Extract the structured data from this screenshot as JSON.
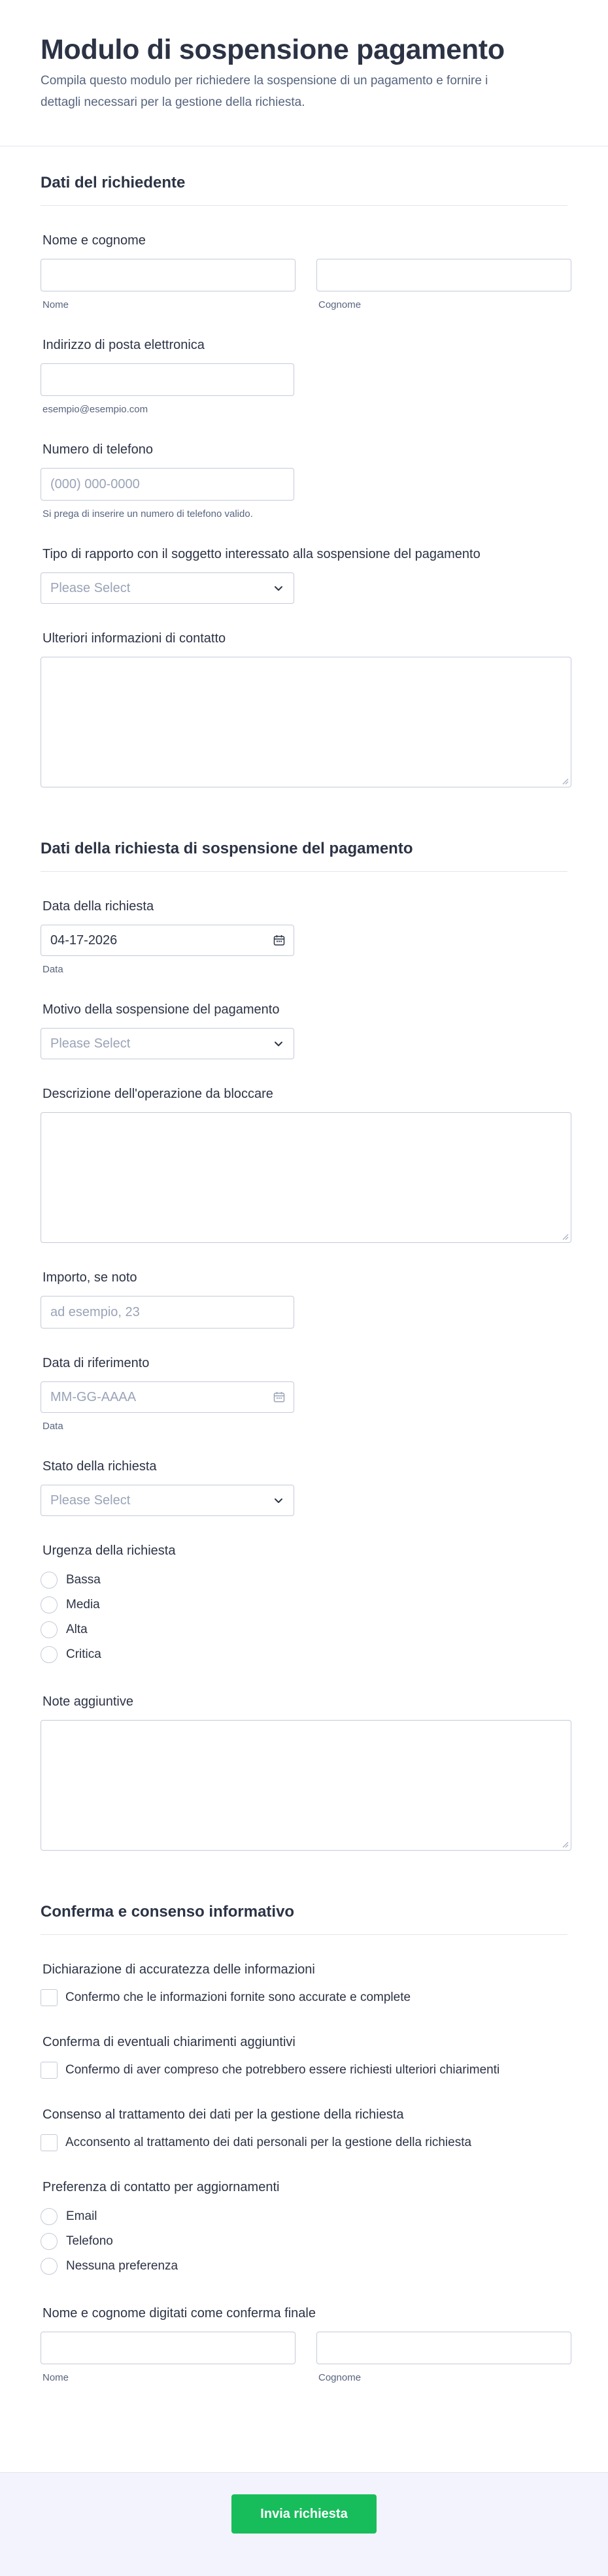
{
  "header": {
    "title": "Modulo di sospensione pagamento",
    "subtitle": "Compila questo modulo per richiedere la sospensione di un pagamento e fornire i dettagli necessari per la gestione della richiesta."
  },
  "section_applicant": {
    "title": "Dati del richiedente",
    "name": {
      "label": "Nome e cognome",
      "first_sublabel": "Nome",
      "last_sublabel": "Cognome",
      "first_value": "",
      "last_value": ""
    },
    "email": {
      "label": "Indirizzo di posta elettronica",
      "value": "",
      "sublabel": "esempio@esempio.com"
    },
    "phone": {
      "label": "Numero di telefono",
      "placeholder": "(000) 000-0000",
      "sublabel": "Si prega di inserire un numero di telefono valido."
    },
    "relationship": {
      "label": "Tipo di rapporto con il soggetto interessato alla sospensione del pagamento",
      "placeholder": "Please Select"
    },
    "extra_contact": {
      "label": "Ulteriori informazioni di contatto",
      "value": ""
    }
  },
  "section_request": {
    "title": "Dati della richiesta di sospensione del pagamento",
    "request_date": {
      "label": "Data della richiesta",
      "value": "04-17-2026",
      "sublabel": "Data"
    },
    "reason": {
      "label": "Motivo della sospensione del pagamento",
      "placeholder": "Please Select"
    },
    "description": {
      "label": "Descrizione dell'operazione da bloccare",
      "value": ""
    },
    "amount": {
      "label": "Importo, se noto",
      "placeholder": "ad esempio, 23"
    },
    "reference_date": {
      "label": "Data di riferimento",
      "placeholder": "MM-GG-AAAA",
      "sublabel": "Data"
    },
    "status": {
      "label": "Stato della richiesta",
      "placeholder": "Please Select"
    },
    "urgency": {
      "label": "Urgenza della richiesta",
      "options": [
        "Bassa",
        "Media",
        "Alta",
        "Critica"
      ]
    },
    "notes": {
      "label": "Note aggiuntive",
      "value": ""
    }
  },
  "section_confirm": {
    "title": "Conferma e consenso informativo",
    "accuracy": {
      "label": "Dichiarazione di accuratezza delle informazioni",
      "option": "Confermo che le informazioni fornite sono accurate e complete"
    },
    "clarifications": {
      "label": "Conferma di eventuali chiarimenti aggiuntivi",
      "option": "Confermo di aver compreso che potrebbero essere richiesti ulteriori chiarimenti"
    },
    "consent": {
      "label": "Consenso al trattamento dei dati per la gestione della richiesta",
      "option": "Acconsento al trattamento dei dati personali per la gestione della richiesta"
    },
    "contact_pref": {
      "label": "Preferenza di contatto per aggiornamenti",
      "options": [
        "Email",
        "Telefono",
        "Nessuna preferenza"
      ]
    },
    "final_name": {
      "label": "Nome e cognome digitati come conferma finale",
      "first_sublabel": "Nome",
      "last_sublabel": "Cognome",
      "first_value": "",
      "last_value": ""
    }
  },
  "footer": {
    "submit_label": "Invia richiesta"
  },
  "colors": {
    "accent": "#18bd5b",
    "text": "#2c3345",
    "muted": "#57647e",
    "border": "#c3cad8"
  },
  "icons": {
    "select": "chevron-down-icon",
    "date": "calendar-icon"
  }
}
